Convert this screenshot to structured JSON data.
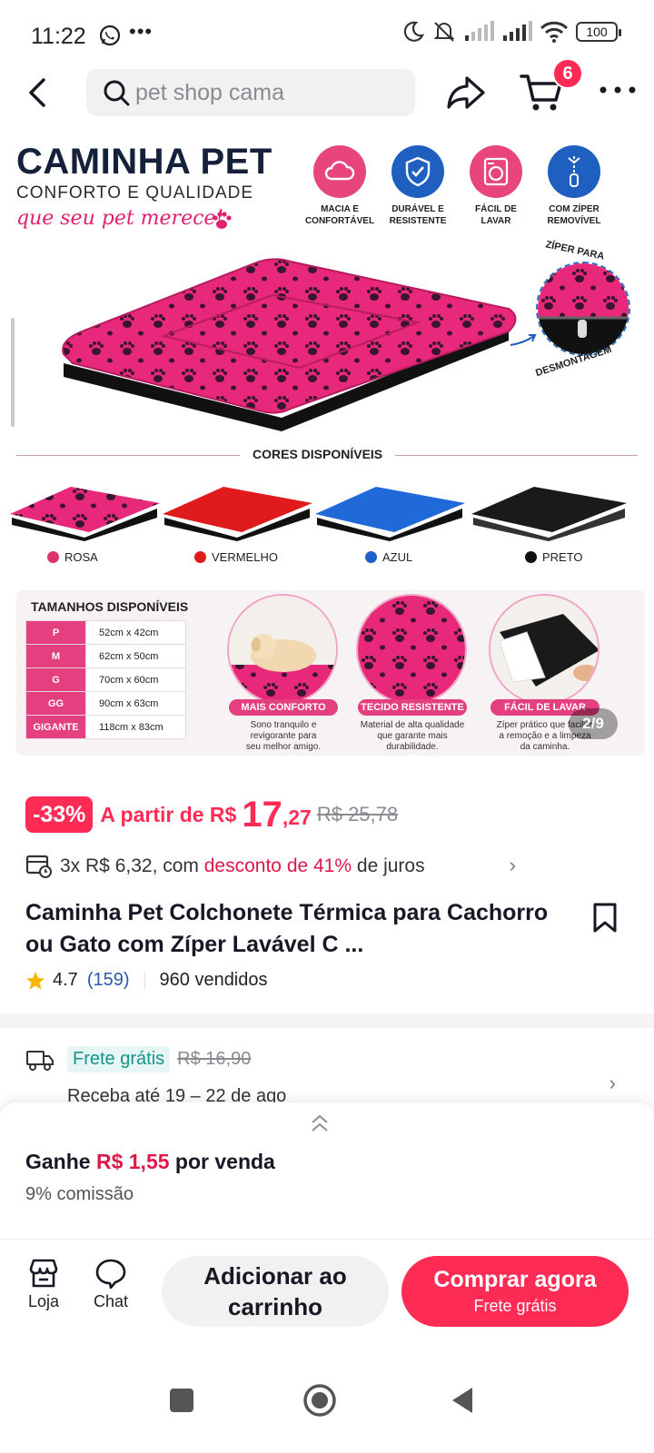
{
  "status_bar": {
    "time": "11:22",
    "battery": "100"
  },
  "search": {
    "placeholder": "pet shop cama"
  },
  "cart": {
    "count": "6"
  },
  "gallery": {
    "title": "CAMINHA PET",
    "subtitle": "CONFORTO E QUALIDADE",
    "tagline": "que seu pet merece!",
    "features": [
      {
        "label_1": "MACIA E",
        "label_2": "CONFORTÁVEL",
        "color": "#e8457e",
        "icon": "cloud-icon"
      },
      {
        "label_1": "DURÁVEL E",
        "label_2": "RESISTENTE",
        "color": "#1f5fbf",
        "icon": "shield-check-icon"
      },
      {
        "label_1": "FÁCIL DE",
        "label_2": "LAVAR",
        "color": "#e8457e",
        "icon": "washing-machine-icon"
      },
      {
        "label_1": "COM ZÍPER",
        "label_2": "REMOVÍVEL",
        "color": "#1f5fbf",
        "icon": "zipper-icon"
      }
    ],
    "zipper_top": "ZÍPER PARA",
    "zipper_bottom": "DESMONTAGEM",
    "colors_title": "CORES DISPONÍVEIS",
    "colors": [
      {
        "name": "ROSA",
        "hex": "#e0326f"
      },
      {
        "name": "VERMELHO",
        "hex": "#e01b1b"
      },
      {
        "name": "AZUL",
        "hex": "#1f5fc8"
      },
      {
        "name": "PRETO",
        "hex": "#111111"
      }
    ],
    "sizes_title": "TAMANHOS DISPONÍVEIS",
    "sizes": [
      {
        "size": "P",
        "dims": "52cm x 42cm"
      },
      {
        "size": "M",
        "dims": "62cm x 50cm"
      },
      {
        "size": "G",
        "dims": "70cm x 60cm"
      },
      {
        "size": "GG",
        "dims": "90cm x 63cm"
      },
      {
        "size": "GIGANTE",
        "dims": "118cm x 83cm"
      }
    ],
    "highlights": [
      {
        "label": "MAIS CONFORTO",
        "desc_1": "Sono tranquilo e",
        "desc_2": "revigorante para",
        "desc_3": "seu melhor amigo."
      },
      {
        "label": "TECIDO RESISTENTE",
        "desc_1": "Material de alta qualidade",
        "desc_2": "que garante mais",
        "desc_3": "durabilidade."
      },
      {
        "label": "FÁCIL DE LAVAR",
        "desc_1": "Zíper prático que facilita",
        "desc_2": "a remoção e a limpeza",
        "desc_3": "da caminha."
      }
    ],
    "page_indicator": "2/9"
  },
  "price": {
    "discount": "-33%",
    "from_label": "A partir de R$",
    "integer": "17",
    "cents": ",27",
    "old": "R$ 25,78"
  },
  "installments": {
    "prefix": "3x R$ 6,32, com",
    "highlight": "desconto de 41%",
    "suffix": "de juros"
  },
  "product": {
    "title": "Caminha Pet Colchonete Térmica para Cachorro ou Gato com Zíper Lavável C ...",
    "rating": "4.7",
    "reviews": "(159)",
    "sold": "960 vendidos"
  },
  "shipping": {
    "free_label": "Frete grátis",
    "old_price": "R$ 16,90",
    "delivery": "Receba até 19 – 22 de ago"
  },
  "commission": {
    "gain_prefix": "Ganhe",
    "gain_amount": "R$ 1,55",
    "gain_suffix": "por venda",
    "rate": "9% comissão"
  },
  "actions": {
    "store": "Loja",
    "chat": "Chat",
    "add_to_cart": "Adicionar ao carrinho",
    "buy_now": "Comprar agora",
    "buy_now_sub": "Frete grátis"
  }
}
